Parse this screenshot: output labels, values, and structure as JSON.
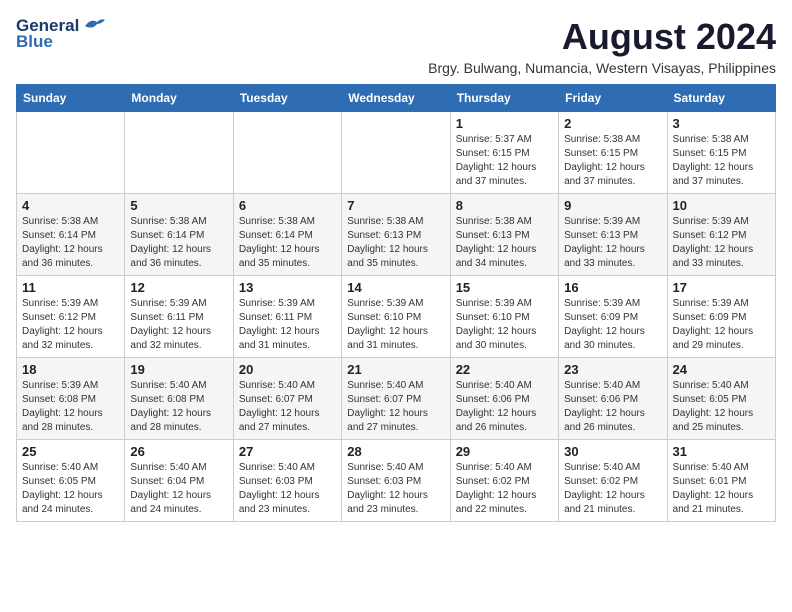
{
  "logo": {
    "line1": "General",
    "line2": "Blue"
  },
  "title": "August 2024",
  "subtitle": "Brgy. Bulwang, Numancia, Western Visayas, Philippines",
  "headers": [
    "Sunday",
    "Monday",
    "Tuesday",
    "Wednesday",
    "Thursday",
    "Friday",
    "Saturday"
  ],
  "weeks": [
    [
      {
        "day": "",
        "info": ""
      },
      {
        "day": "",
        "info": ""
      },
      {
        "day": "",
        "info": ""
      },
      {
        "day": "",
        "info": ""
      },
      {
        "day": "1",
        "info": "Sunrise: 5:37 AM\nSunset: 6:15 PM\nDaylight: 12 hours\nand 37 minutes."
      },
      {
        "day": "2",
        "info": "Sunrise: 5:38 AM\nSunset: 6:15 PM\nDaylight: 12 hours\nand 37 minutes."
      },
      {
        "day": "3",
        "info": "Sunrise: 5:38 AM\nSunset: 6:15 PM\nDaylight: 12 hours\nand 37 minutes."
      }
    ],
    [
      {
        "day": "4",
        "info": "Sunrise: 5:38 AM\nSunset: 6:14 PM\nDaylight: 12 hours\nand 36 minutes."
      },
      {
        "day": "5",
        "info": "Sunrise: 5:38 AM\nSunset: 6:14 PM\nDaylight: 12 hours\nand 36 minutes."
      },
      {
        "day": "6",
        "info": "Sunrise: 5:38 AM\nSunset: 6:14 PM\nDaylight: 12 hours\nand 35 minutes."
      },
      {
        "day": "7",
        "info": "Sunrise: 5:38 AM\nSunset: 6:13 PM\nDaylight: 12 hours\nand 35 minutes."
      },
      {
        "day": "8",
        "info": "Sunrise: 5:38 AM\nSunset: 6:13 PM\nDaylight: 12 hours\nand 34 minutes."
      },
      {
        "day": "9",
        "info": "Sunrise: 5:39 AM\nSunset: 6:13 PM\nDaylight: 12 hours\nand 33 minutes."
      },
      {
        "day": "10",
        "info": "Sunrise: 5:39 AM\nSunset: 6:12 PM\nDaylight: 12 hours\nand 33 minutes."
      }
    ],
    [
      {
        "day": "11",
        "info": "Sunrise: 5:39 AM\nSunset: 6:12 PM\nDaylight: 12 hours\nand 32 minutes."
      },
      {
        "day": "12",
        "info": "Sunrise: 5:39 AM\nSunset: 6:11 PM\nDaylight: 12 hours\nand 32 minutes."
      },
      {
        "day": "13",
        "info": "Sunrise: 5:39 AM\nSunset: 6:11 PM\nDaylight: 12 hours\nand 31 minutes."
      },
      {
        "day": "14",
        "info": "Sunrise: 5:39 AM\nSunset: 6:10 PM\nDaylight: 12 hours\nand 31 minutes."
      },
      {
        "day": "15",
        "info": "Sunrise: 5:39 AM\nSunset: 6:10 PM\nDaylight: 12 hours\nand 30 minutes."
      },
      {
        "day": "16",
        "info": "Sunrise: 5:39 AM\nSunset: 6:09 PM\nDaylight: 12 hours\nand 30 minutes."
      },
      {
        "day": "17",
        "info": "Sunrise: 5:39 AM\nSunset: 6:09 PM\nDaylight: 12 hours\nand 29 minutes."
      }
    ],
    [
      {
        "day": "18",
        "info": "Sunrise: 5:39 AM\nSunset: 6:08 PM\nDaylight: 12 hours\nand 28 minutes."
      },
      {
        "day": "19",
        "info": "Sunrise: 5:40 AM\nSunset: 6:08 PM\nDaylight: 12 hours\nand 28 minutes."
      },
      {
        "day": "20",
        "info": "Sunrise: 5:40 AM\nSunset: 6:07 PM\nDaylight: 12 hours\nand 27 minutes."
      },
      {
        "day": "21",
        "info": "Sunrise: 5:40 AM\nSunset: 6:07 PM\nDaylight: 12 hours\nand 27 minutes."
      },
      {
        "day": "22",
        "info": "Sunrise: 5:40 AM\nSunset: 6:06 PM\nDaylight: 12 hours\nand 26 minutes."
      },
      {
        "day": "23",
        "info": "Sunrise: 5:40 AM\nSunset: 6:06 PM\nDaylight: 12 hours\nand 26 minutes."
      },
      {
        "day": "24",
        "info": "Sunrise: 5:40 AM\nSunset: 6:05 PM\nDaylight: 12 hours\nand 25 minutes."
      }
    ],
    [
      {
        "day": "25",
        "info": "Sunrise: 5:40 AM\nSunset: 6:05 PM\nDaylight: 12 hours\nand 24 minutes."
      },
      {
        "day": "26",
        "info": "Sunrise: 5:40 AM\nSunset: 6:04 PM\nDaylight: 12 hours\nand 24 minutes."
      },
      {
        "day": "27",
        "info": "Sunrise: 5:40 AM\nSunset: 6:03 PM\nDaylight: 12 hours\nand 23 minutes."
      },
      {
        "day": "28",
        "info": "Sunrise: 5:40 AM\nSunset: 6:03 PM\nDaylight: 12 hours\nand 23 minutes."
      },
      {
        "day": "29",
        "info": "Sunrise: 5:40 AM\nSunset: 6:02 PM\nDaylight: 12 hours\nand 22 minutes."
      },
      {
        "day": "30",
        "info": "Sunrise: 5:40 AM\nSunset: 6:02 PM\nDaylight: 12 hours\nand 21 minutes."
      },
      {
        "day": "31",
        "info": "Sunrise: 5:40 AM\nSunset: 6:01 PM\nDaylight: 12 hours\nand 21 minutes."
      }
    ]
  ]
}
